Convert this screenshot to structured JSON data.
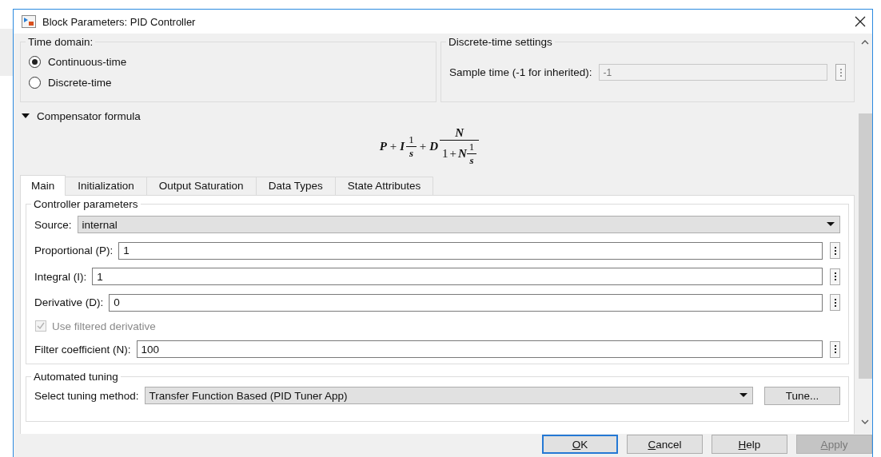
{
  "window": {
    "title": "Block Parameters: PID Controller"
  },
  "time_domain": {
    "title": "Time domain:",
    "options": [
      {
        "label": "Continuous-time",
        "selected": true
      },
      {
        "label": "Discrete-time",
        "selected": false
      }
    ]
  },
  "discrete_settings": {
    "title": "Discrete-time settings",
    "label": "Sample time (-1 for inherited):",
    "value": "-1",
    "disabled": true
  },
  "compensator": {
    "label": "Compensator formula",
    "expanded": true,
    "formula": {
      "p": "P",
      "plus_1": "+",
      "i": "I",
      "i_num": "1",
      "i_den": "s",
      "plus_2": "+",
      "d": "D",
      "d_num": "N",
      "den_one": "1",
      "plus_3": "+",
      "den_n": "N",
      "den_frac_num": "1",
      "den_frac_den": "s"
    }
  },
  "tabs": [
    {
      "label": "Main",
      "selected": true
    },
    {
      "label": "Initialization",
      "selected": false
    },
    {
      "label": "Output Saturation",
      "selected": false
    },
    {
      "label": "Data Types",
      "selected": false
    },
    {
      "label": "State Attributes",
      "selected": false
    }
  ],
  "controller_parameters": {
    "title": "Controller parameters",
    "rows": [
      {
        "kind": "dropdown",
        "label": "Source:",
        "value": "internal"
      },
      {
        "kind": "text",
        "label": "Proportional (P):",
        "value": "1"
      },
      {
        "kind": "text",
        "label": "Integral (I):",
        "value": "1"
      },
      {
        "kind": "text",
        "label": "Derivative (D):",
        "value": "0"
      },
      {
        "kind": "checkbox",
        "label": "Use filtered derivative",
        "checked": true,
        "disabled": true
      },
      {
        "kind": "text",
        "label": "Filter coefficient (N):",
        "value": "100"
      }
    ]
  },
  "automated_tuning": {
    "title": "Automated tuning",
    "label": "Select tuning method:",
    "value": "Transfer Function Based (PID Tuner App)",
    "button": "Tune..."
  },
  "buttons": [
    {
      "label": "OK",
      "default": true,
      "disabled": false
    },
    {
      "label": "Cancel",
      "default": false,
      "disabled": false
    },
    {
      "label": "Help",
      "default": false,
      "disabled": false
    },
    {
      "label": "Apply",
      "default": false,
      "disabled": true
    }
  ]
}
